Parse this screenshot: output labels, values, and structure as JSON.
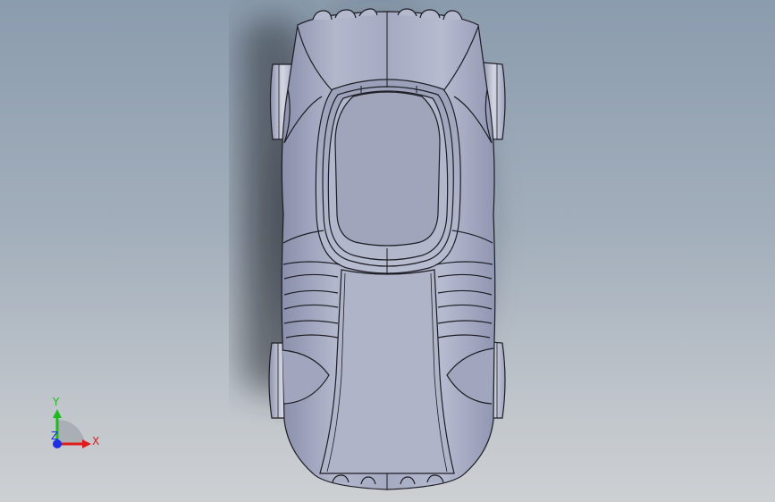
{
  "viewport": {
    "model": "car-body-top-view",
    "colors": {
      "background_top": "#8b9cae",
      "background_bottom": "#cdd0d3",
      "body": "#a9aec4",
      "body_light": "#c7cbdc",
      "body_dark": "#7f859f",
      "edge": "#1d1d24",
      "shadow": "#2a2f36"
    }
  },
  "triad": {
    "x_label": "X",
    "y_label": "Y",
    "z_label": "Z",
    "colors": {
      "x": "#e01b1b",
      "y": "#1dbb1d",
      "z": "#1d2fe0"
    }
  }
}
